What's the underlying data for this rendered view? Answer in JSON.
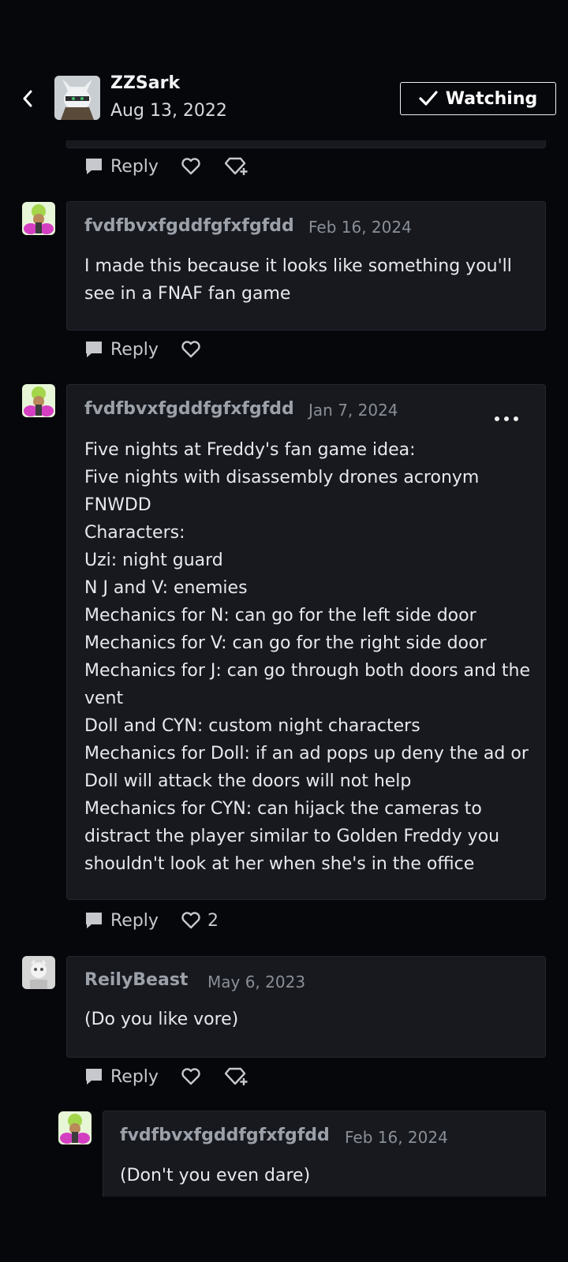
{
  "header": {
    "author_name": "ZZSark",
    "author_date": "Aug 13, 2022",
    "watch_label": "Watching"
  },
  "comments": [
    {
      "username": "fvdfbvxfgddfgfxfgfdd",
      "date": "Feb 16, 2024",
      "text": "I made this because it looks like something you'll see in a FNAF fan game",
      "reply_label": "Reply"
    },
    {
      "username": "fvdfbvxfgddfgfxfgfdd",
      "date": "Jan 7, 2024",
      "text": "Five nights at Freddy's fan game idea:\nFive nights with disassembly drones acronym FNWDD\nCharacters:\nUzi: night guard\nN J and V: enemies\nMechanics for N: can go for the left side door\nMechanics for V: can go for the right side door\nMechanics for J: can go through both doors and the vent\nDoll and CYN: custom night characters\nMechanics for Doll: if an ad pops up deny the ad or Doll will attack the doors will not help\nMechanics for CYN: can hijack the cameras to distract the player similar to Golden Freddy  you shouldn't look at her when she's in the office",
      "reply_label": "Reply",
      "like_count": "2"
    },
    {
      "username": "ReilyBeast",
      "date": "May 6, 2023",
      "text": "(Do you like vore)",
      "reply_label": "Reply"
    },
    {
      "username": "fvdfbvxfgddfgfxfgfdd",
      "date": "Feb 16, 2024",
      "text": "(Don't you even dare)"
    }
  ],
  "top_actions": {
    "reply_label": "Reply"
  },
  "colors": {
    "background": "#06070b",
    "card": "#17191f",
    "username": "#9ca0a8",
    "date": "#8a8e96",
    "text": "#e8e9ec"
  }
}
